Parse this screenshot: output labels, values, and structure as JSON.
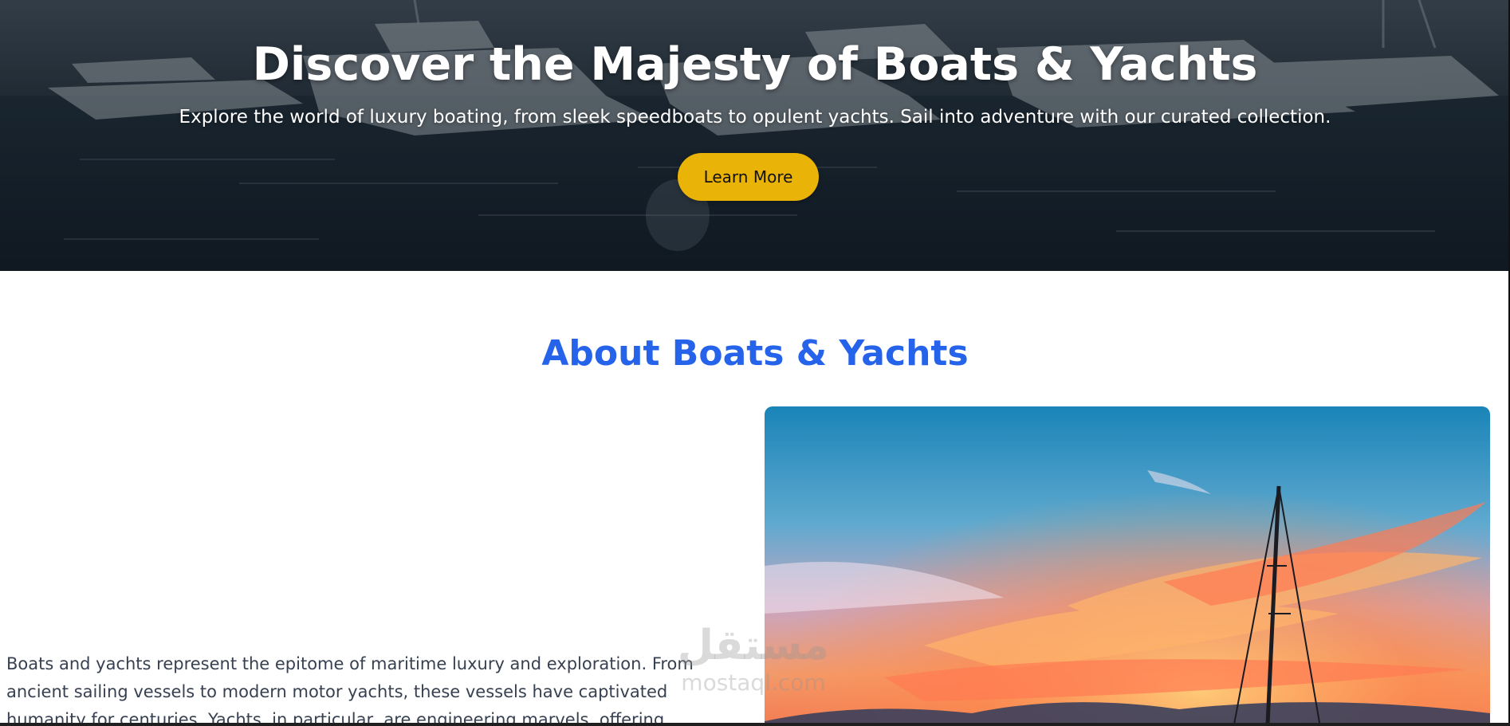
{
  "hero": {
    "title": "Discover the Majesty of Boats & Yachts",
    "subtitle": "Explore the world of luxury boating, from sleek speedboats to opulent yachts. Sail into adventure with our curated collection.",
    "button_label": "Learn More",
    "button_color": "#eab308"
  },
  "about": {
    "title": "About Boats & Yachts",
    "title_color": "#2563eb",
    "paragraph": "Boats and yachts represent the epitome of maritime luxury and exploration. From ancient sailing vessels to modern motor yachts, these vessels have captivated humanity for centuries. Yachts, in particular, are engineering marvels, offering unparalleled comfort"
  },
  "watermark": {
    "logo": "مستقل",
    "text": "mostaql.com"
  }
}
